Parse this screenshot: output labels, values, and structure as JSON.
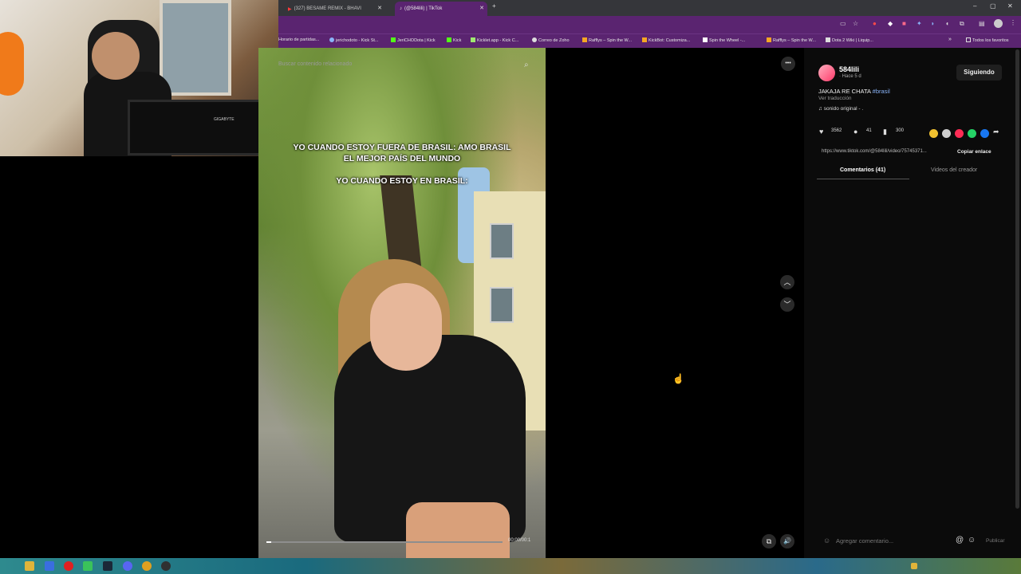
{
  "browser": {
    "tabs": [
      {
        "label": "(327) BESAME REMIX - BHAVI"
      },
      {
        "label": "(@584lili) | TikTok"
      }
    ],
    "new_tab": "+",
    "window_controls": {
      "minimize": "–",
      "maximize": "▢",
      "close": "✕"
    },
    "bookmarks": [
      "Horario de partidas...",
      "jerichodoto - Kick St...",
      "JeriCHODota | Kick",
      "Kick",
      "Kicklet.app - Kick C...",
      "Correo de Zoho",
      "Rafflys – Spin the W...",
      "KickBot: Customiza...",
      "Spin the Wheel -...",
      "Rafflys – Spin the W...",
      "Dota 2 Wiki | Liquip..."
    ],
    "bookmarks_more": "»",
    "all_bookmarks": "Todos los favoritos"
  },
  "webcam": {
    "monitor_brand": "GIGABYTE"
  },
  "video": {
    "search_hint": "Buscar contenido relacionado",
    "caption_line1": "YO CUANDO ESTOY FUERA DE BRASIL: AMO BRASIL",
    "caption_line2": "EL MEJOR PAÍS DEL MUNDO",
    "caption_line3": "YO CUANDO ESTOY EN BRASIL:",
    "time": "00:00/00:1",
    "progress": 0.02
  },
  "controls": {
    "more": "•••",
    "up": "︿",
    "down": "﹀",
    "pip": "⧉",
    "volume": "🔊"
  },
  "post": {
    "username": "584lili",
    "sub": "· Hace 5 d",
    "follow_label": "Siguiendo",
    "description": "JAKAJA RE CHATA ",
    "hashtag": "#brasil",
    "translate": "Ver traducción",
    "sound": "sonido original - .",
    "likes": "3562",
    "comments": "41",
    "saves": "300",
    "link": "https://www.tiktok.com/@584lili/video/75745371...",
    "copy_link": "Copiar enlace",
    "tab_comments": "Comentarios (41)",
    "tab_creator": "Videos del creador",
    "comment_placeholder": "Agregar comentario...",
    "publish": "Publicar"
  },
  "colors": {
    "accent": "#5a2470",
    "hashtag": "#8ab4f8",
    "panel": "#0b0b0b"
  }
}
